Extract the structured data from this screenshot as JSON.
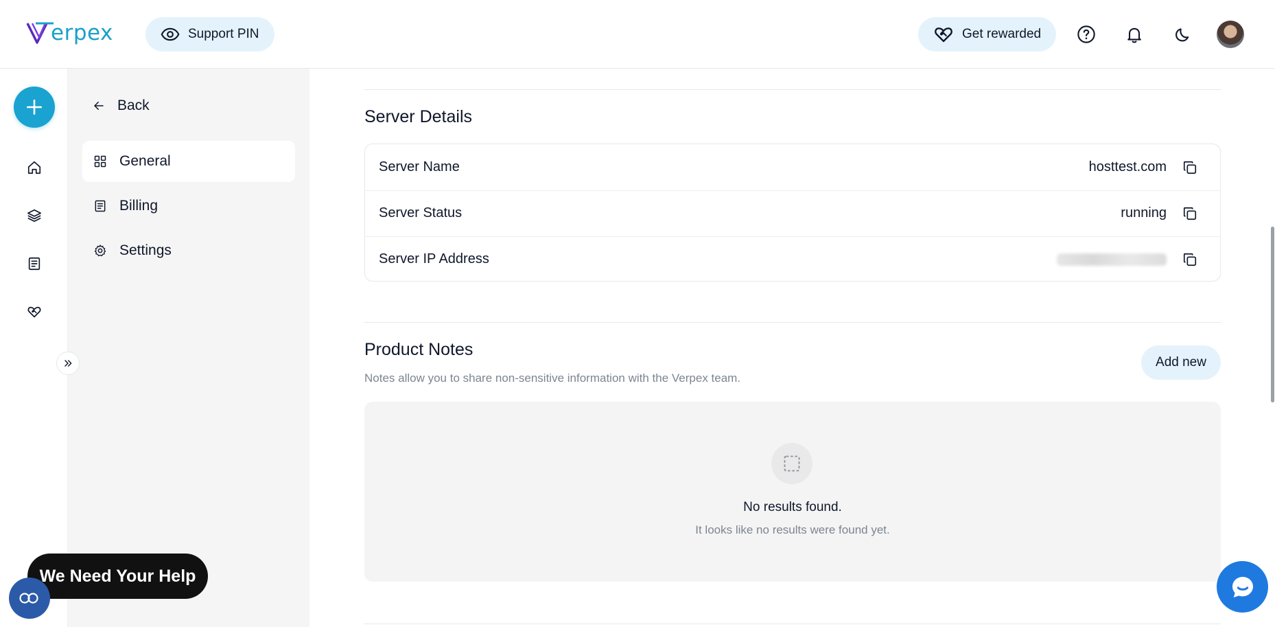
{
  "brand": {
    "logo_text": "erpex",
    "accent": "#1aa3d1"
  },
  "header": {
    "support_pin_label": "Support PIN",
    "get_rewarded_label": "Get rewarded",
    "icons": [
      "eye-icon",
      "heart-handshake-icon",
      "help-icon",
      "bell-icon",
      "moon-icon"
    ]
  },
  "rail": {
    "icons": [
      "plus-icon",
      "home-icon",
      "layers-icon",
      "document-icon",
      "heart-handshake-icon",
      "double-chevron-right-icon"
    ]
  },
  "subnav": {
    "back_label": "Back",
    "items": [
      {
        "label": "General",
        "icon": "grid-icon",
        "active": true
      },
      {
        "label": "Billing",
        "icon": "receipt-icon",
        "active": false
      },
      {
        "label": "Settings",
        "icon": "gear-icon",
        "active": false
      }
    ]
  },
  "server_details": {
    "title": "Server Details",
    "rows": [
      {
        "label": "Server Name",
        "value": "hosttest.com"
      },
      {
        "label": "Server Status",
        "value": "running"
      },
      {
        "label": "Server IP Address",
        "value": ""
      }
    ]
  },
  "product_notes": {
    "title": "Product Notes",
    "subtitle": "Notes allow you to share non-sensitive information with the Verpex team.",
    "add_new_label": "Add new",
    "empty_title": "No results found.",
    "empty_description": "It looks like no results were found yet."
  },
  "floating": {
    "help_banner": "We Need Your Help",
    "cookie_icon": "cookie-settings-icon",
    "chat_icon": "chat-icon"
  }
}
